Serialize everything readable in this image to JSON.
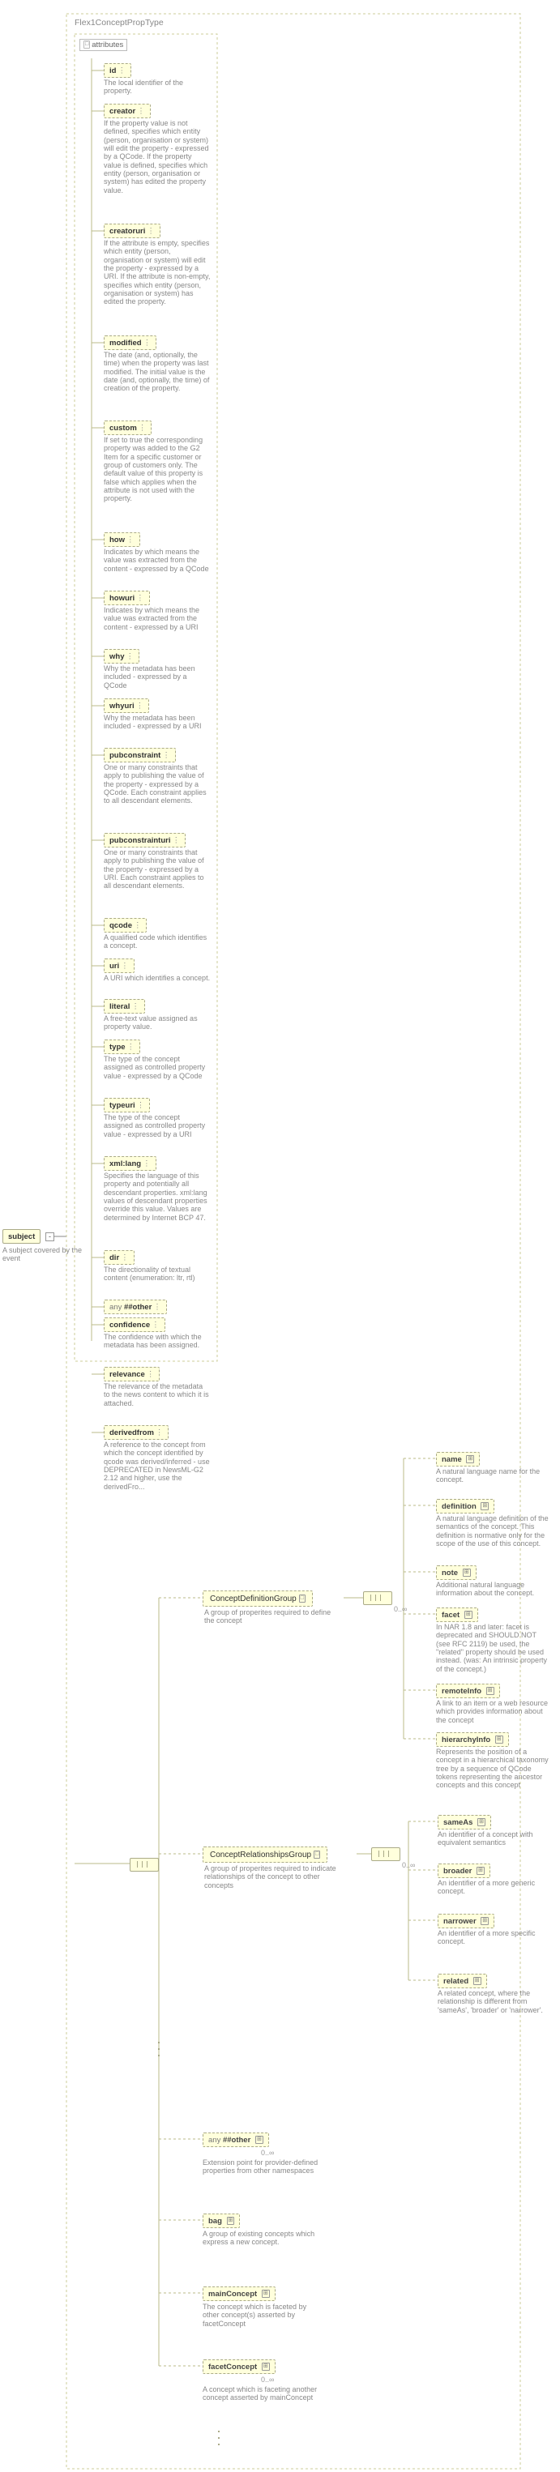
{
  "root": {
    "name": "subject",
    "desc": "A subject covered by the event"
  },
  "typeTitle": "Flex1ConceptPropType",
  "attrBox": "attributes",
  "attrs": [
    {
      "k": "id",
      "d": "The local identifier of the property."
    },
    {
      "k": "creator",
      "d": "If the property value is not defined, specifies which entity (person, organisation or system) will edit the property - expressed by a QCode. If the property value is defined, specifies which entity (person, organisation or system) has edited the property value."
    },
    {
      "k": "creatoruri",
      "d": "If the attribute is empty, specifies which entity (person, organisation or system) will edit the property - expressed by a URI. If the attribute is non-empty, specifies which entity (person, organisation or system) has edited the property."
    },
    {
      "k": "modified",
      "d": "The date (and, optionally, the time) when the property was last modified. The initial value is the date (and, optionally, the time) of creation of the property."
    },
    {
      "k": "custom",
      "d": "If set to true the corresponding property was added to the G2 Item for a specific customer or group of customers only. The default value of this property is false which applies when the attribute is not used with the property."
    },
    {
      "k": "how",
      "d": "Indicates by which means the value was extracted from the content - expressed by a QCode"
    },
    {
      "k": "howuri",
      "d": "Indicates by which means the value was extracted from the content - expressed by a URI"
    },
    {
      "k": "why",
      "d": "Why the metadata has been included - expressed by a QCode"
    },
    {
      "k": "whyuri",
      "d": "Why the metadata has been included - expressed by a URI"
    },
    {
      "k": "pubconstraint",
      "d": "One or many constraints that apply to publishing the value of the property - expressed by a QCode. Each constraint applies to all descendant elements."
    },
    {
      "k": "pubconstrainturi",
      "d": "One or many constraints that apply to publishing the value of the property - expressed by a URI. Each constraint applies to all descendant elements."
    },
    {
      "k": "qcode",
      "d": "A qualified code which identifies a concept."
    },
    {
      "k": "uri",
      "d": "A URI which identifies a concept."
    },
    {
      "k": "literal",
      "d": "A free-text value assigned as property value."
    },
    {
      "k": "type",
      "d": "The type of the concept assigned as controlled property value - expressed by a QCode"
    },
    {
      "k": "typeuri",
      "d": "The type of the concept assigned as controlled property value - expressed by a URI"
    },
    {
      "k": "xml:lang",
      "d": "Specifies the language of this property and potentially all descendant properties. xml:lang values of descendant properties override this value. Values are determined by Internet BCP 47."
    },
    {
      "k": "dir",
      "d": "The directionality of textual content (enumeration: ltr, rtl)"
    },
    {
      "k": "any ##other",
      "d": "",
      "other": true
    },
    {
      "k": "confidence",
      "d": "The confidence with which the metadata has been assigned."
    },
    {
      "k": "relevance",
      "d": "The relevance of the metadata to the news content to which it is attached."
    },
    {
      "k": "derivedfrom",
      "d": "A reference to the concept from which the concept identified by qcode was derived/inferred - use DEPRECATED in NewsML-G2 2.12 and higher, use the derivedFro..."
    }
  ],
  "groups": {
    "cd": {
      "label": "ConceptDefinitionGroup",
      "desc": "A group of properites required to define the concept",
      "max": "0..∞",
      "items": [
        {
          "k": "name",
          "d": "A natural language name for the concept."
        },
        {
          "k": "definition",
          "d": "A natural language definition of the semantics of the concept. This definition is normative only for the scope of the use of this concept."
        },
        {
          "k": "note",
          "d": "Additional natural language information about the concept."
        },
        {
          "k": "facet",
          "d": "In NAR 1.8 and later: facet is deprecated and SHOULD NOT (see RFC 2119) be used, the \"related\" property should be used instead. (was: An intrinsic property of the concept.)"
        },
        {
          "k": "remoteInfo",
          "d": "A link to an item or a web resource which provides information about the concept"
        },
        {
          "k": "hierarchyInfo",
          "d": "Represents the position of a concept in a hierarchical taxonomy tree by a sequence of QCode tokens representing the ancestor concepts and this concept"
        }
      ]
    },
    "cr": {
      "label": "ConceptRelationshipsGroup",
      "desc": "A group of properites required to indicate relationships of the concept to other concepts",
      "max": "0..∞",
      "items": [
        {
          "k": "sameAs",
          "d": "An identifier of a concept with equivalent semantics"
        },
        {
          "k": "broader",
          "d": "An identifier of a more generic concept."
        },
        {
          "k": "narrower",
          "d": "An identifier of a more specific concept."
        },
        {
          "k": "related",
          "d": "A related concept, where the relationship is different from 'sameAs', 'broader' or 'narrower'."
        }
      ]
    }
  },
  "tail": [
    {
      "k": "any ##other",
      "d": "Extension point for provider-defined properties from other namespaces",
      "other": true,
      "max": "0..∞"
    },
    {
      "k": "bag",
      "d": "A group of existing concepts which express a new concept."
    },
    {
      "k": "mainConcept",
      "d": "The concept which is faceted by other concept(s) asserted by facetConcept"
    },
    {
      "k": "facetConcept",
      "d": "A concept which is faceting another concept asserted by mainConcept",
      "max": "0..∞"
    }
  ],
  "chart_data": {
    "type": "tree-schema-diagram"
  }
}
